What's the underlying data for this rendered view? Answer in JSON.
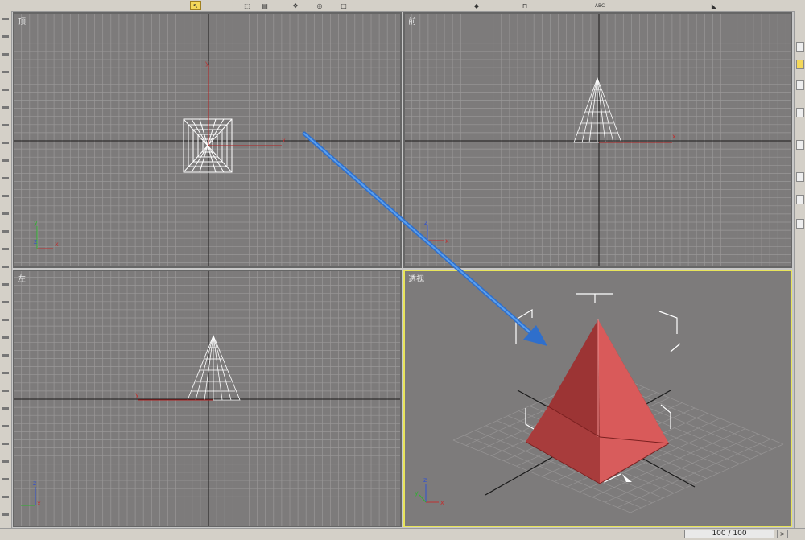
{
  "toolbar": {
    "buttons": [
      {
        "name": "select-tool-icon",
        "glyph": "↖",
        "active": true
      },
      {
        "name": "region-select-icon",
        "glyph": "⬚",
        "active": false
      },
      {
        "name": "select-by-name-icon",
        "glyph": "▤",
        "active": false
      },
      {
        "name": "move-tool-icon",
        "glyph": "✥",
        "active": false
      },
      {
        "name": "rotate-tool-icon",
        "glyph": "◎",
        "active": false
      },
      {
        "name": "scale-tool-icon",
        "glyph": "□",
        "active": false
      },
      {
        "name": "mirror-tool-icon",
        "glyph": "◆",
        "active": false
      },
      {
        "name": "align-tool-icon",
        "glyph": "⊓",
        "active": false
      },
      {
        "name": "spell-check-icon",
        "glyph": "ABC",
        "active": false
      },
      {
        "name": "render-setup-icon",
        "glyph": "◣",
        "active": false
      }
    ]
  },
  "viewports": {
    "top": {
      "label": "顶"
    },
    "front": {
      "label": "前"
    },
    "left": {
      "label": "左"
    },
    "perspective": {
      "label": "透视"
    }
  },
  "axis_labels": {
    "x": "x",
    "y": "y",
    "z": "z"
  },
  "statusbar": {
    "frame_counter": "100 / 100",
    "next_frame_glyph": ">"
  },
  "colors": {
    "viewport_bg": "#7d7b7b",
    "grid_line": "#9a9898",
    "axis_line": "#1a1a1a",
    "active_border": "#e8e45a",
    "pyramid_light": "#d95a5a",
    "pyramid_dark": "#9c3434",
    "annotation_arrow": "#3a7fd6"
  }
}
